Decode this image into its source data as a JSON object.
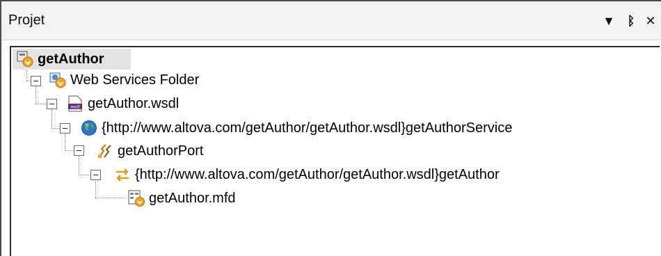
{
  "panel": {
    "title": "Projet",
    "menu_glyph": "▼",
    "pin_glyph": "ᛒ",
    "close_glyph": "✕"
  },
  "tree": {
    "root": "getAuthor",
    "folder": "Web Services Folder",
    "wsdl": "getAuthor.wsdl",
    "service": "{http://www.altova.com/getAuthor/getAuthor.wsdl}getAuthorService",
    "port": "getAuthorPort",
    "operation": "{http://www.altova.com/getAuthor/getAuthor.wsdl}getAuthor",
    "mapping": "getAuthor.mfd"
  },
  "icons": {
    "root": "project-icon",
    "folder": "web-services-folder-icon",
    "wsdl": "wsdl-file-icon",
    "service": "globe-icon",
    "port": "port-icon",
    "operation": "operation-icon",
    "mapping": "mapping-file-icon"
  }
}
